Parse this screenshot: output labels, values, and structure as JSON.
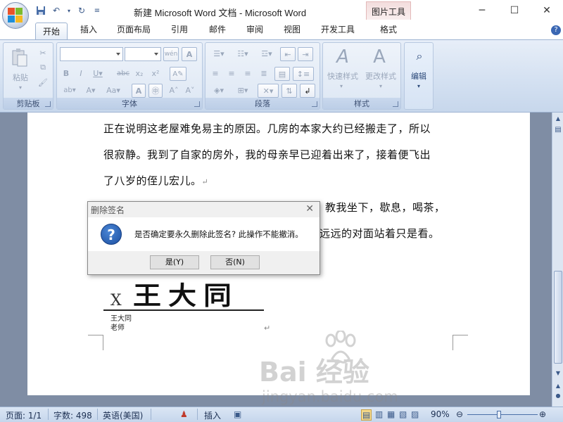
{
  "titlebar": {
    "title": "新建 Microsoft Word 文档 - Microsoft Word",
    "context_tab": "图片工具",
    "minimize": "─",
    "maximize": "☐",
    "close": "✕"
  },
  "tabs": [
    {
      "label": "开始"
    },
    {
      "label": "插入"
    },
    {
      "label": "页面布局"
    },
    {
      "label": "引用"
    },
    {
      "label": "邮件"
    },
    {
      "label": "审阅"
    },
    {
      "label": "视图"
    },
    {
      "label": "开发工具"
    },
    {
      "label": "格式"
    }
  ],
  "ribbon": {
    "clipboard": {
      "label": "剪贴板",
      "paste": "粘贴"
    },
    "font": {
      "label": "字体"
    },
    "paragraph": {
      "label": "段落"
    },
    "styles": {
      "label": "样式",
      "quick_styles": "快速样式",
      "change_styles": "更改样式"
    },
    "editing": {
      "label": "编辑"
    }
  },
  "document": {
    "lines": [
      "正在说明这老屋难免易主的原因。几房的本家大约已经搬走了，所以",
      "很寂静。我到了自家的房外，我的母亲早已迎着出来了，接着便飞出",
      "了八岁的侄儿宏儿。",
      "",
      ""
    ],
    "line4_tail": "着，教我坐下，歇息，喝茶，",
    "line5_tail": "远远的对面站着只是看。",
    "signature": {
      "x_mark": "X",
      "image_text": "王大同",
      "name": "王大同",
      "title": "老师"
    }
  },
  "dialog": {
    "title": "删除签名",
    "message": "是否确定要永久删除此签名? 此操作不能撤消。",
    "yes": "是(Y)",
    "no": "否(N)"
  },
  "statusbar": {
    "page": "页面: 1/1",
    "words": "字数: 498",
    "language": "英语(美国)",
    "insert": "插入",
    "zoom": "90%"
  },
  "watermark": {
    "text": "Bai  经验",
    "url": "jingyan.baidu.com"
  }
}
